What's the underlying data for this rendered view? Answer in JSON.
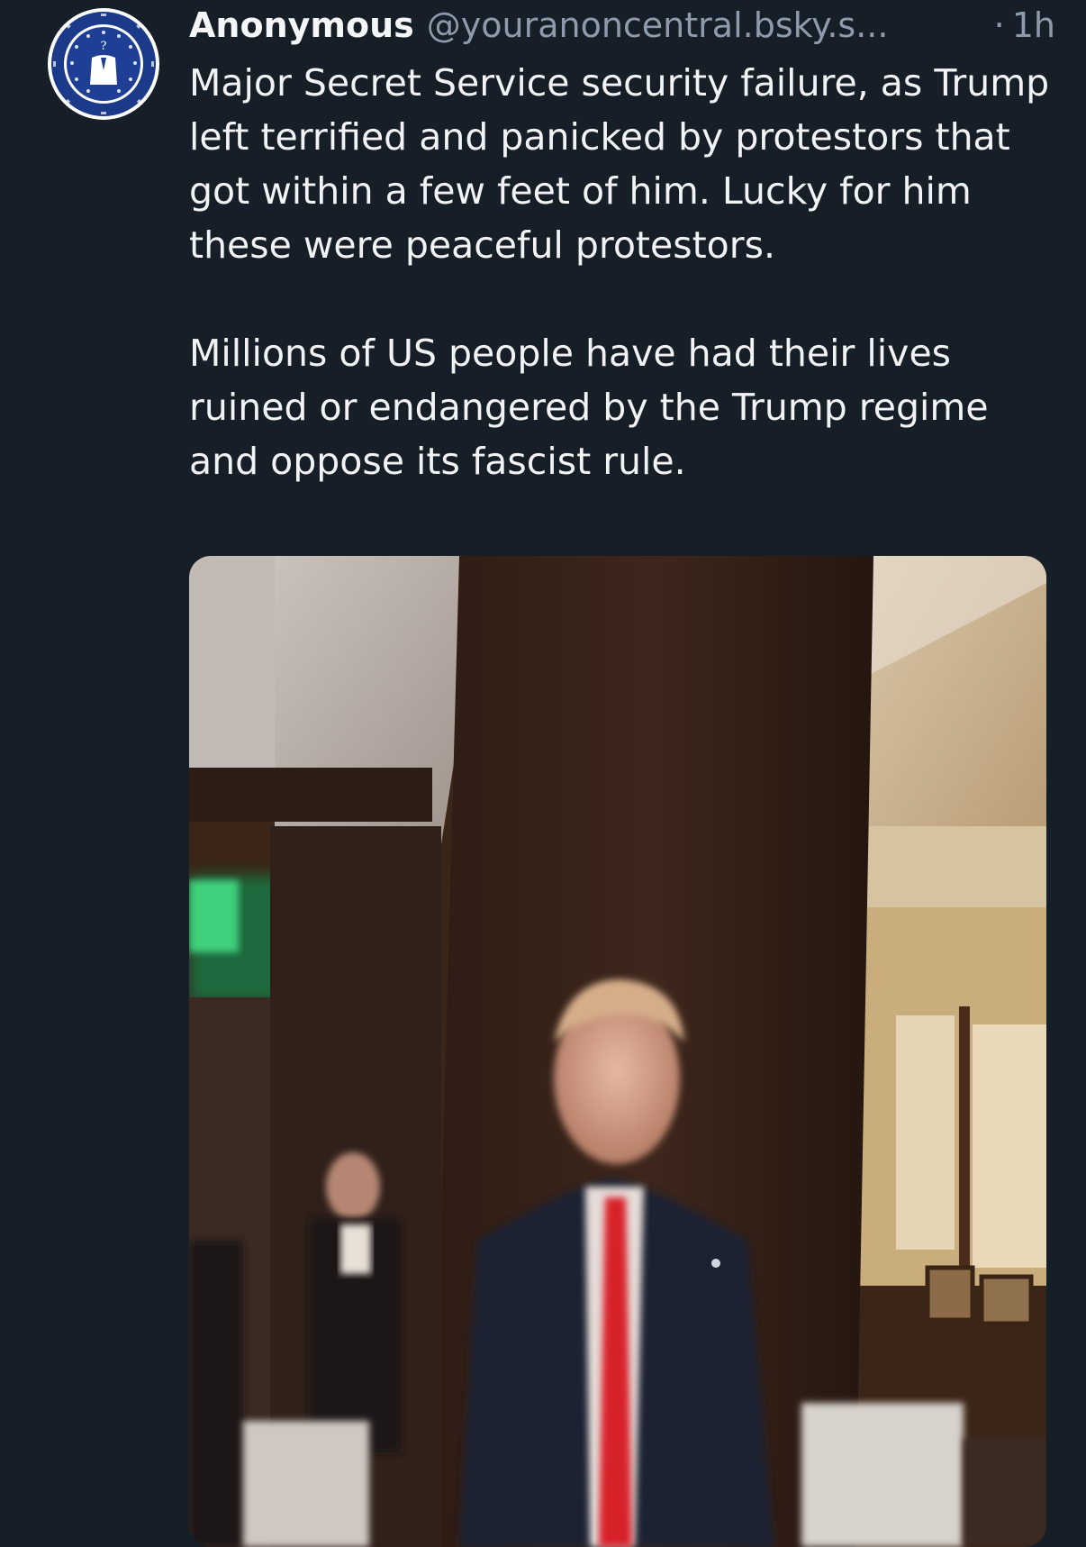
{
  "post": {
    "author": {
      "display_name": "Anonymous",
      "handle": "@youranoncentral.bsky.s...",
      "avatar_icon": "anonymous-seal-icon"
    },
    "separator": "·",
    "timestamp": "1h",
    "text": {
      "paragraph_1": "Major Secret Service security failure, as Trump left terrified and panicked by protestors that got within a few feet of him. Lucky for him these were peaceful protestors.",
      "paragraph_2": "Millions of US people have had their lives ruined or endangered by the Trump regime and oppose its fascist rule."
    },
    "media": {
      "type": "video-thumbnail"
    }
  },
  "colors": {
    "background": "#161e27",
    "text_primary": "#f1f3f5",
    "text_secondary": "#8e9bab",
    "avatar_blue": "#1c3a8a"
  }
}
